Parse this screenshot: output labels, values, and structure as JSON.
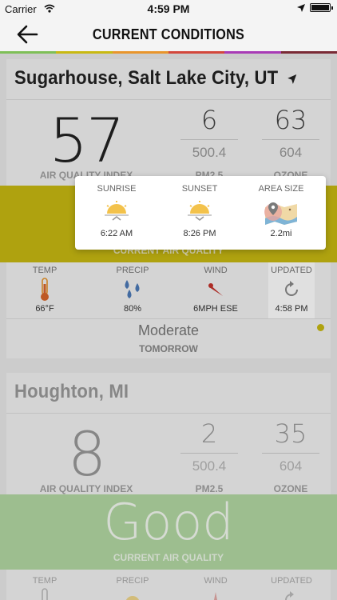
{
  "status_bar": {
    "carrier": "Carrier",
    "time": "4:59 PM"
  },
  "nav": {
    "title": "CURRENT CONDITIONS"
  },
  "rainbow_colors": [
    "#7ebf57",
    "#c8b912",
    "#e8952c",
    "#d3473c",
    "#a83bb6",
    "#7a2a35"
  ],
  "locations": [
    {
      "name": "Sugarhouse, Salt Lake City, UT",
      "aqi": "57",
      "pm25": {
        "current": "6",
        "raw": "500.4"
      },
      "ozone": {
        "current": "63",
        "raw": "604"
      },
      "labels": {
        "aqi": "AIR QUALITY INDEX",
        "pm25": "PM2.5",
        "ozone": "OZONE"
      },
      "band_color": "#c8b912",
      "band_label": "CURRENT AIR QUALITY",
      "weather": {
        "temp": {
          "label": "TEMP",
          "value": "66°F"
        },
        "precip": {
          "label": "PRECIP",
          "value": "80%"
        },
        "wind": {
          "label": "WIND",
          "value": "6MPH ESE"
        },
        "updated": {
          "label": "UPDATED",
          "value": "4:58 PM"
        }
      },
      "forecast": {
        "quality": "Moderate",
        "when": "TOMORROW"
      }
    },
    {
      "name": "Houghton, MI",
      "aqi": "8",
      "pm25": {
        "current": "2",
        "raw": "500.4"
      },
      "ozone": {
        "current": "35",
        "raw": "604"
      },
      "labels": {
        "aqi": "AIR QUALITY INDEX",
        "pm25": "PM2.5",
        "ozone": "OZONE"
      },
      "band_color": "#b3d9a3",
      "band_big": "Good",
      "band_label": "CURRENT AIR QUALITY",
      "weather": {
        "temp": {
          "label": "TEMP"
        },
        "precip": {
          "label": "PRECIP"
        },
        "wind": {
          "label": "WIND"
        },
        "updated": {
          "label": "UPDATED"
        }
      }
    }
  ],
  "popover": {
    "sunrise": {
      "label": "SUNRISE",
      "value": "6:22 AM"
    },
    "sunset": {
      "label": "SUNSET",
      "value": "8:26 PM"
    },
    "area": {
      "label": "AREA SIZE",
      "value": "2.2mi"
    }
  }
}
